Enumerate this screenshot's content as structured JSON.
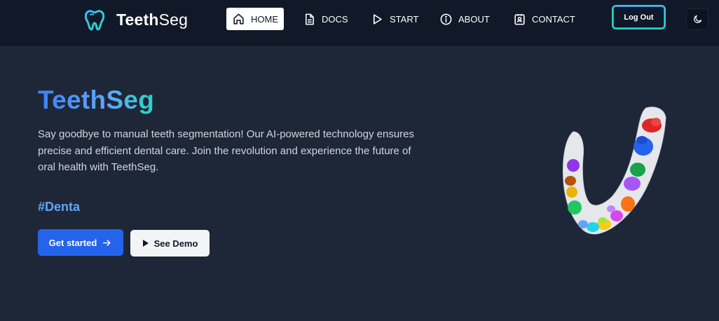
{
  "brand": {
    "name_bold": "Teeth",
    "name_light": "Seg",
    "icon": "tooth-icon"
  },
  "nav": {
    "items": [
      {
        "label": "HOME",
        "icon": "home-icon",
        "active": true
      },
      {
        "label": "DOCS",
        "icon": "document-icon"
      },
      {
        "label": "START",
        "icon": "play-icon"
      },
      {
        "label": "ABOUT",
        "icon": "info-icon"
      },
      {
        "label": "CONTACT",
        "icon": "contact-icon"
      }
    ],
    "logout_label": "Log Out",
    "theme_icon": "moon-icon"
  },
  "hero": {
    "title": "TeethSeg",
    "description": "Say goodbye to manual teeth segmentation! Our AI-powered technology ensures precise and efficient dental care. Join the revolution and experience the future of oral health with TeethSeg.",
    "hashtag": "#Denta",
    "primary_button": "Get started",
    "secondary_button": "See Demo",
    "image": "segmented-jaw-3d-model"
  },
  "colors": {
    "background": "#1e2738",
    "navbar": "#111827",
    "accent": "#3b82f6",
    "primary_button": "#2563eb"
  }
}
